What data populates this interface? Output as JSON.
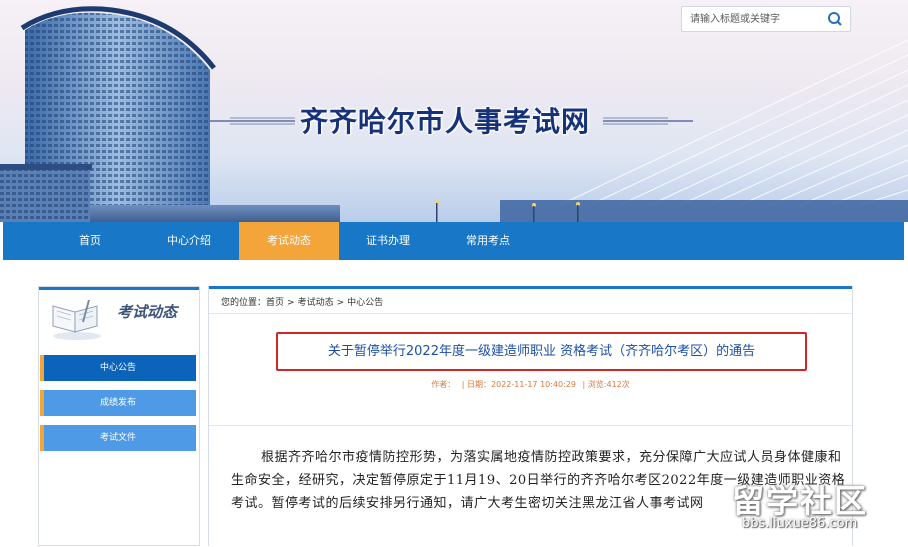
{
  "search": {
    "placeholder": "请输入标题或关键字",
    "icon": "search-icon"
  },
  "site": {
    "title": "齐齐哈尔市人事考试网"
  },
  "nav": {
    "items": [
      {
        "label": "首页"
      },
      {
        "label": "中心介绍"
      },
      {
        "label": "考试动态",
        "active": true
      },
      {
        "label": "证书办理"
      },
      {
        "label": "常用考点"
      }
    ]
  },
  "sidebar": {
    "title": "考试动态",
    "icon": "book-icon",
    "items": [
      {
        "label": "中心公告",
        "active": true
      },
      {
        "label": "成绩发布"
      },
      {
        "label": "考试文件"
      }
    ]
  },
  "breadcrumb": {
    "prefix": "您的位置：",
    "items": [
      "首页",
      "考试动态",
      "中心公告"
    ],
    "separator": ">"
  },
  "article": {
    "title": "关于暂停举行2022年度一级建造师职业 资格考试（齐齐哈尔考区）的通告",
    "meta": {
      "author": "作者：",
      "date": "| 日期：2022-11-17 10:40:29",
      "views": "| 浏览:412次"
    },
    "paragraph": "根据齐齐哈尔市疫情防控形势，为落实属地疫情防控政策要求，充分保障广大应试人员身体健康和生命安全，经研究，决定暂停原定于11月19、20日举行的齐齐哈尔考区2022年度一级建造师职业资格考试。暂停考试的后续安排另行通知，请广大考生密切关注黑龙江省人事考试网"
  },
  "watermark": {
    "text": "留学社区",
    "url": "bbs.liuxue86.com"
  },
  "colors": {
    "nav": "#1877c6",
    "active": "#f3a53a",
    "title": "#15327a",
    "highlight": "#cf2727",
    "side_active": "#0b64b9",
    "side_item": "#4f9ae6"
  }
}
